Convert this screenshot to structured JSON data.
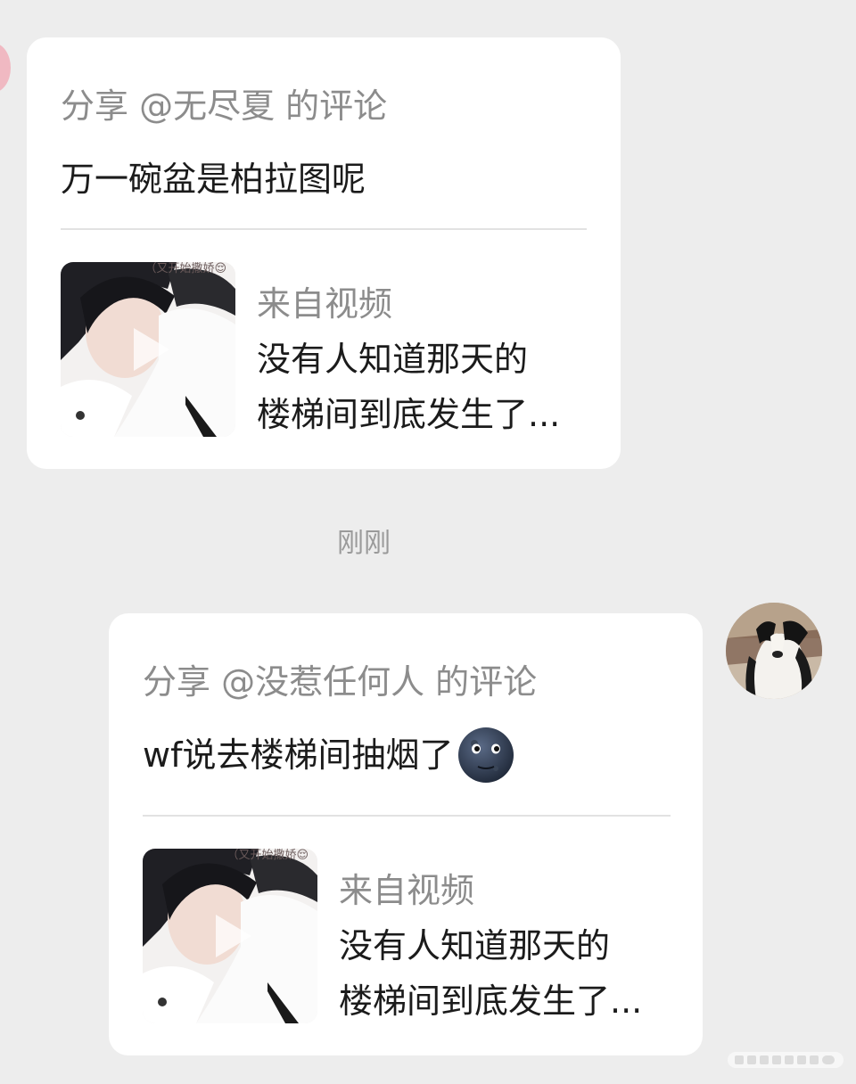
{
  "messages": [
    {
      "side": "left",
      "share_header": "分享 @无尽夏 的评论",
      "comment": "万一碗盆是柏拉图呢",
      "video": {
        "from_label": "来自视频",
        "title_line1": "没有人知道那天的",
        "title_line2": "楼梯间到底发生了...",
        "thumb_caption": "（又开始撒娇😌"
      }
    },
    {
      "side": "right",
      "share_header": "分享 @没惹任何人 的评论",
      "comment": "wf说去楼梯间抽烟了",
      "comment_emoji": "new-moon-face",
      "video": {
        "from_label": "来自视频",
        "title_line1": "没有人知道那天的",
        "title_line2": "楼梯间到底发生了...",
        "thumb_caption": "（又开始撒娇😌"
      }
    }
  ],
  "timestamp": "刚刚",
  "colors": {
    "background": "#ededed",
    "bubble": "#ffffff",
    "muted_text": "#8c8c8c",
    "primary_text": "#1b1b1b"
  }
}
